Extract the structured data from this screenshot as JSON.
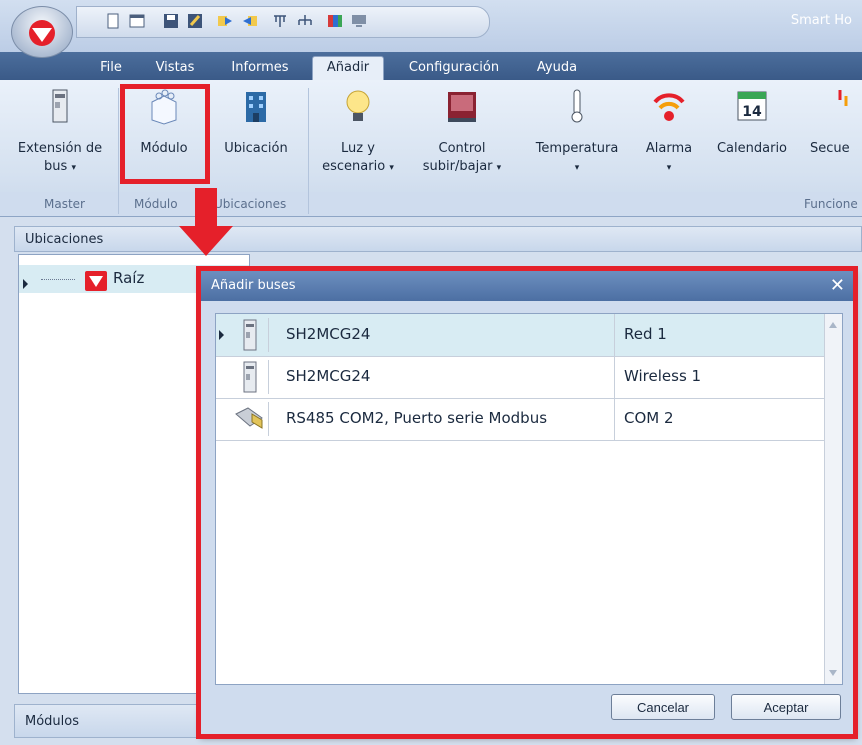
{
  "app": {
    "title": "Smart Ho"
  },
  "menu_tabs": [
    "File",
    "Vistas",
    "Informes",
    "Añadir",
    "Configuración",
    "Ayuda"
  ],
  "active_tab": "Añadir",
  "ribbon": {
    "buttons": {
      "extension": {
        "label": "Extensión de",
        "label2": "bus"
      },
      "modulo": {
        "label": "Módulo"
      },
      "ubicacion": {
        "label": "Ubicación"
      },
      "luz": {
        "label": "Luz y",
        "label2": "escenario"
      },
      "control": {
        "label": "Control",
        "label2": "subir/bajar"
      },
      "temperatura": {
        "label": "Temperatura"
      },
      "alarma": {
        "label": "Alarma"
      },
      "calendario": {
        "label": "Calendario",
        "day": "14"
      },
      "secuencia": {
        "label": "Secue"
      }
    },
    "groups": [
      "Master",
      "Módulo",
      "Ubicaciones",
      "Funcione"
    ],
    "dropdown_glyph": "▾"
  },
  "panels": {
    "ubicaciones": "Ubicaciones",
    "modulos": "Módulos"
  },
  "tree": {
    "root_label": "Raíz"
  },
  "dialog": {
    "title": "Añadir buses",
    "close_glyph": "✕",
    "rows": [
      {
        "name": "SH2MCG24",
        "value": "Red 1",
        "icon": "module-device-icon"
      },
      {
        "name": "SH2MCG24",
        "value": "Wireless 1",
        "icon": "module-device-icon"
      },
      {
        "name": "RS485 COM2, Puerto serie Modbus",
        "value": "COM 2",
        "icon": "serial-port-icon"
      }
    ],
    "cancel_label": "Cancelar",
    "accept_label": "Aceptar"
  },
  "colors": {
    "annotation_red": "#e5202a",
    "menu_bar": "#3a5a88",
    "selection": "#d8ecf3"
  }
}
